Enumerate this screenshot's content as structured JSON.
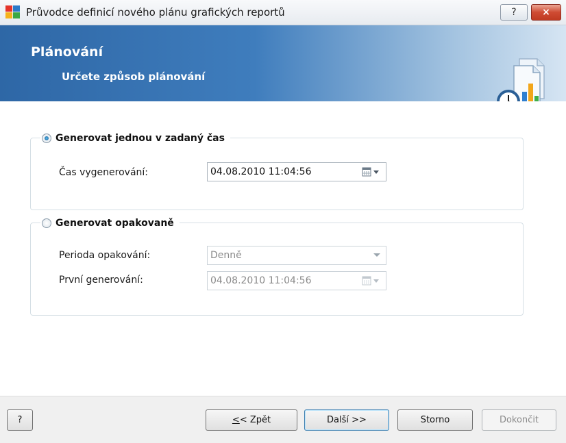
{
  "window": {
    "title": "Průvodce definicí nového plánu grafických reportů",
    "help_glyph": "?",
    "close_glyph": "×"
  },
  "header": {
    "title": "Plánování",
    "subtitle": "Určete způsob plánování"
  },
  "option_once": {
    "label": "Generovat jednou v zadaný čas",
    "selected": true,
    "time_label": "Čas vygenerování:",
    "time_value": "04.08.2010 11:04:56"
  },
  "option_repeat": {
    "label": "Generovat opakovaně",
    "selected": false,
    "period_label": "Perioda opakování:",
    "period_value": "Denně",
    "first_label": "První generování:",
    "first_value": "04.08.2010 11:04:56"
  },
  "buttons": {
    "help": "?",
    "back_prefix": "<",
    "back_rest": "< Zpět",
    "next": "Další >>",
    "cancel": "Storno",
    "finish": "Dokončit"
  },
  "icons": {
    "app": "avg-logo-icon",
    "header": "report-schedule-icon",
    "calendar": "calendar-icon",
    "dropdown": "chevron-down-icon"
  }
}
